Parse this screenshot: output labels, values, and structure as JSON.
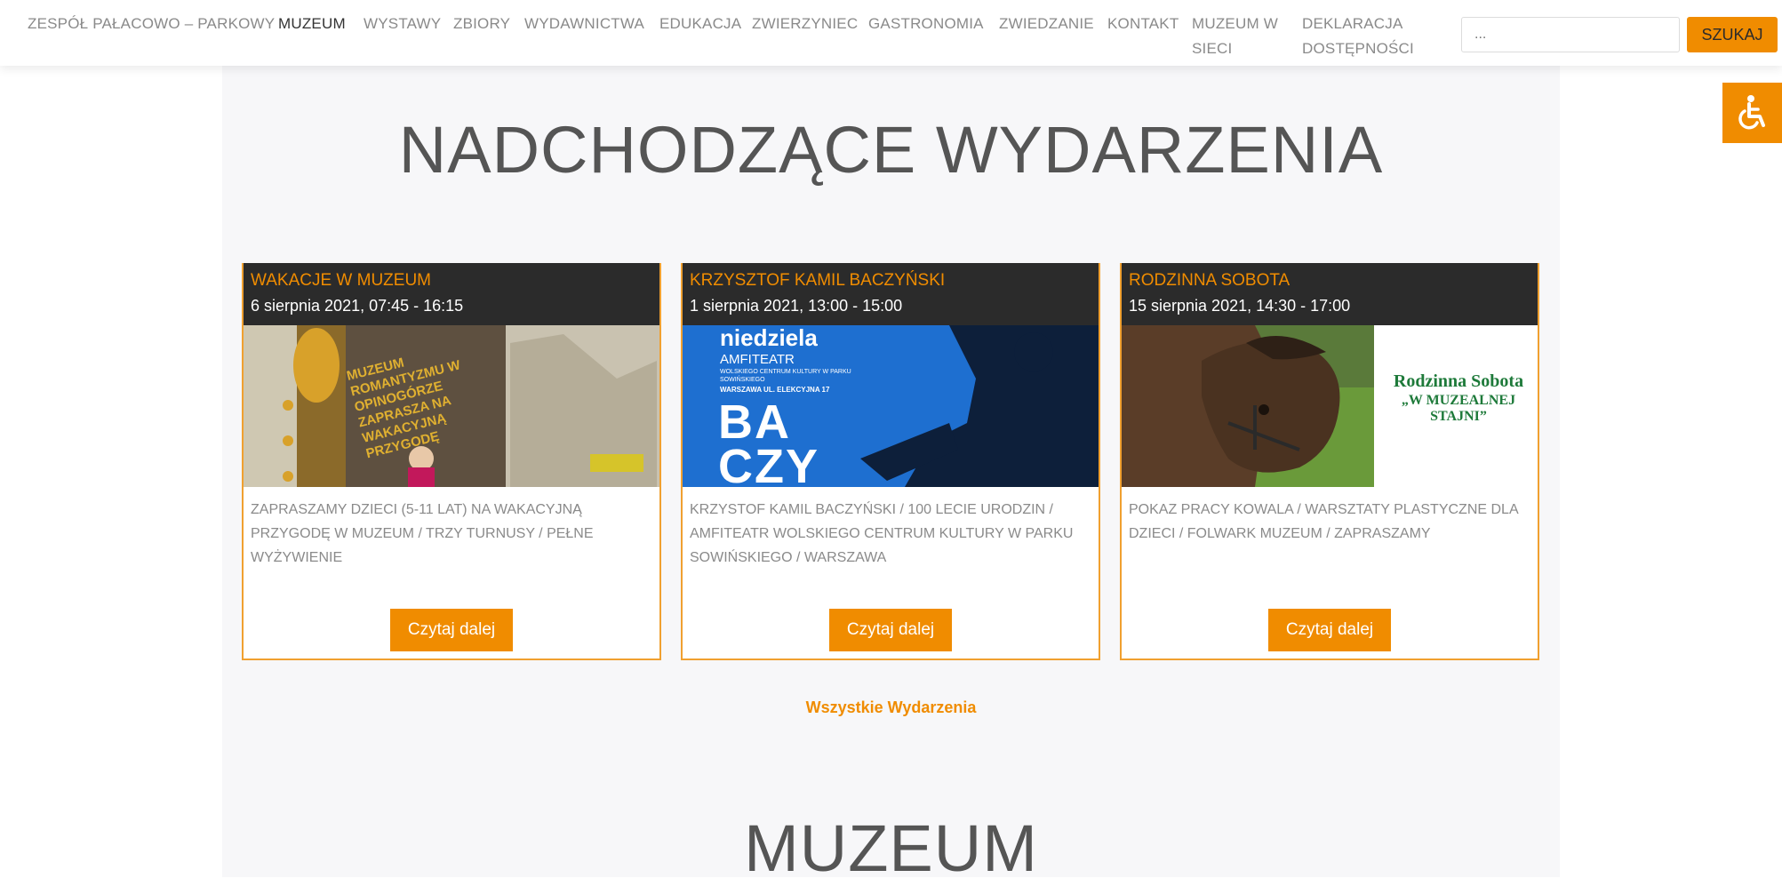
{
  "nav": {
    "items": [
      "ZESPÓŁ PAŁACOWO – PARKOWY",
      "MUZEUM",
      "WYSTAWY",
      "ZBIORY",
      "WYDAWNICTWA",
      "EDUKACJA",
      "ZWIERZYNIEC",
      "GASTRONOMIA",
      "ZWIEDZANIE",
      "KONTAKT",
      "MUZEUM W SIECI",
      "DEKLARACJA DOSTĘPNOŚCI"
    ],
    "search_placeholder": "...",
    "search_button": "SZUKAJ"
  },
  "accessibility": {
    "icon": "wheelchair-icon",
    "color": "#f08c00"
  },
  "events": {
    "title": "NADCHODZĄCE WYDARZENIA",
    "cards": [
      {
        "title": "WAKACJE W MUZEUM",
        "date": "6 sierpnia 2021, 07:45 - 16:15",
        "image_text": "MUZEUM ROMANTYZMU W OPINOGÓRZE ZAPRASZA NA WAKACYJNĄ PRZYGODĘ",
        "description": "ZAPRASZAMY DZIECI (5-11 LAT) NA WAKACYJNĄ PRZYGODĘ W MUZEUM / TRZY TURNUSY / PEŁNE WYŻYWIENIE",
        "button": "Czytaj dalej"
      },
      {
        "title": "KRZYSZTOF KAMIL BACZYŃSKI",
        "date": "1 sierpnia 2021, 13:00 - 15:00",
        "image_text": {
          "day": "niedziela",
          "venue": "AMFITEATR",
          "sub": "WOLSKIEGO CENTRUM KULTURY W PARKU SOWIŃSKIEGO",
          "address": "WARSZAWA UL. ELEKCYJNA 17",
          "big1": "BA",
          "big2": "CZY"
        },
        "description": "KRZYSTOF KAMIL BACZYŃSKI / 100 LECIE URODZIN / AMFITEATR WOLSKIEGO CENTRUM KULTURY W PARKU SOWIŃSKIEGO / WARSZAWA",
        "button": "Czytaj dalej"
      },
      {
        "title": "RODZINNA SOBOTA",
        "date": "15 sierpnia 2021, 14:30 - 17:00",
        "image_text": {
          "line1": "Rodzinna Sobota",
          "line2": "„W MUZEALNEJ",
          "line3": "STAJNI”"
        },
        "description": "POKAZ PRACY KOWALA / WARSZTATY PLASTYCZNE DLA DZIECI / FOLWARK MUZEUM / ZAPRASZAMY",
        "button": "Czytaj dalej"
      }
    ],
    "all_link": "Wszystkie Wydarzenia"
  },
  "museum": {
    "title": "MUZEUM"
  },
  "colors": {
    "accent": "#f08c00",
    "dark": "#2b2b2b",
    "content_bg": "#f7f7f9"
  }
}
